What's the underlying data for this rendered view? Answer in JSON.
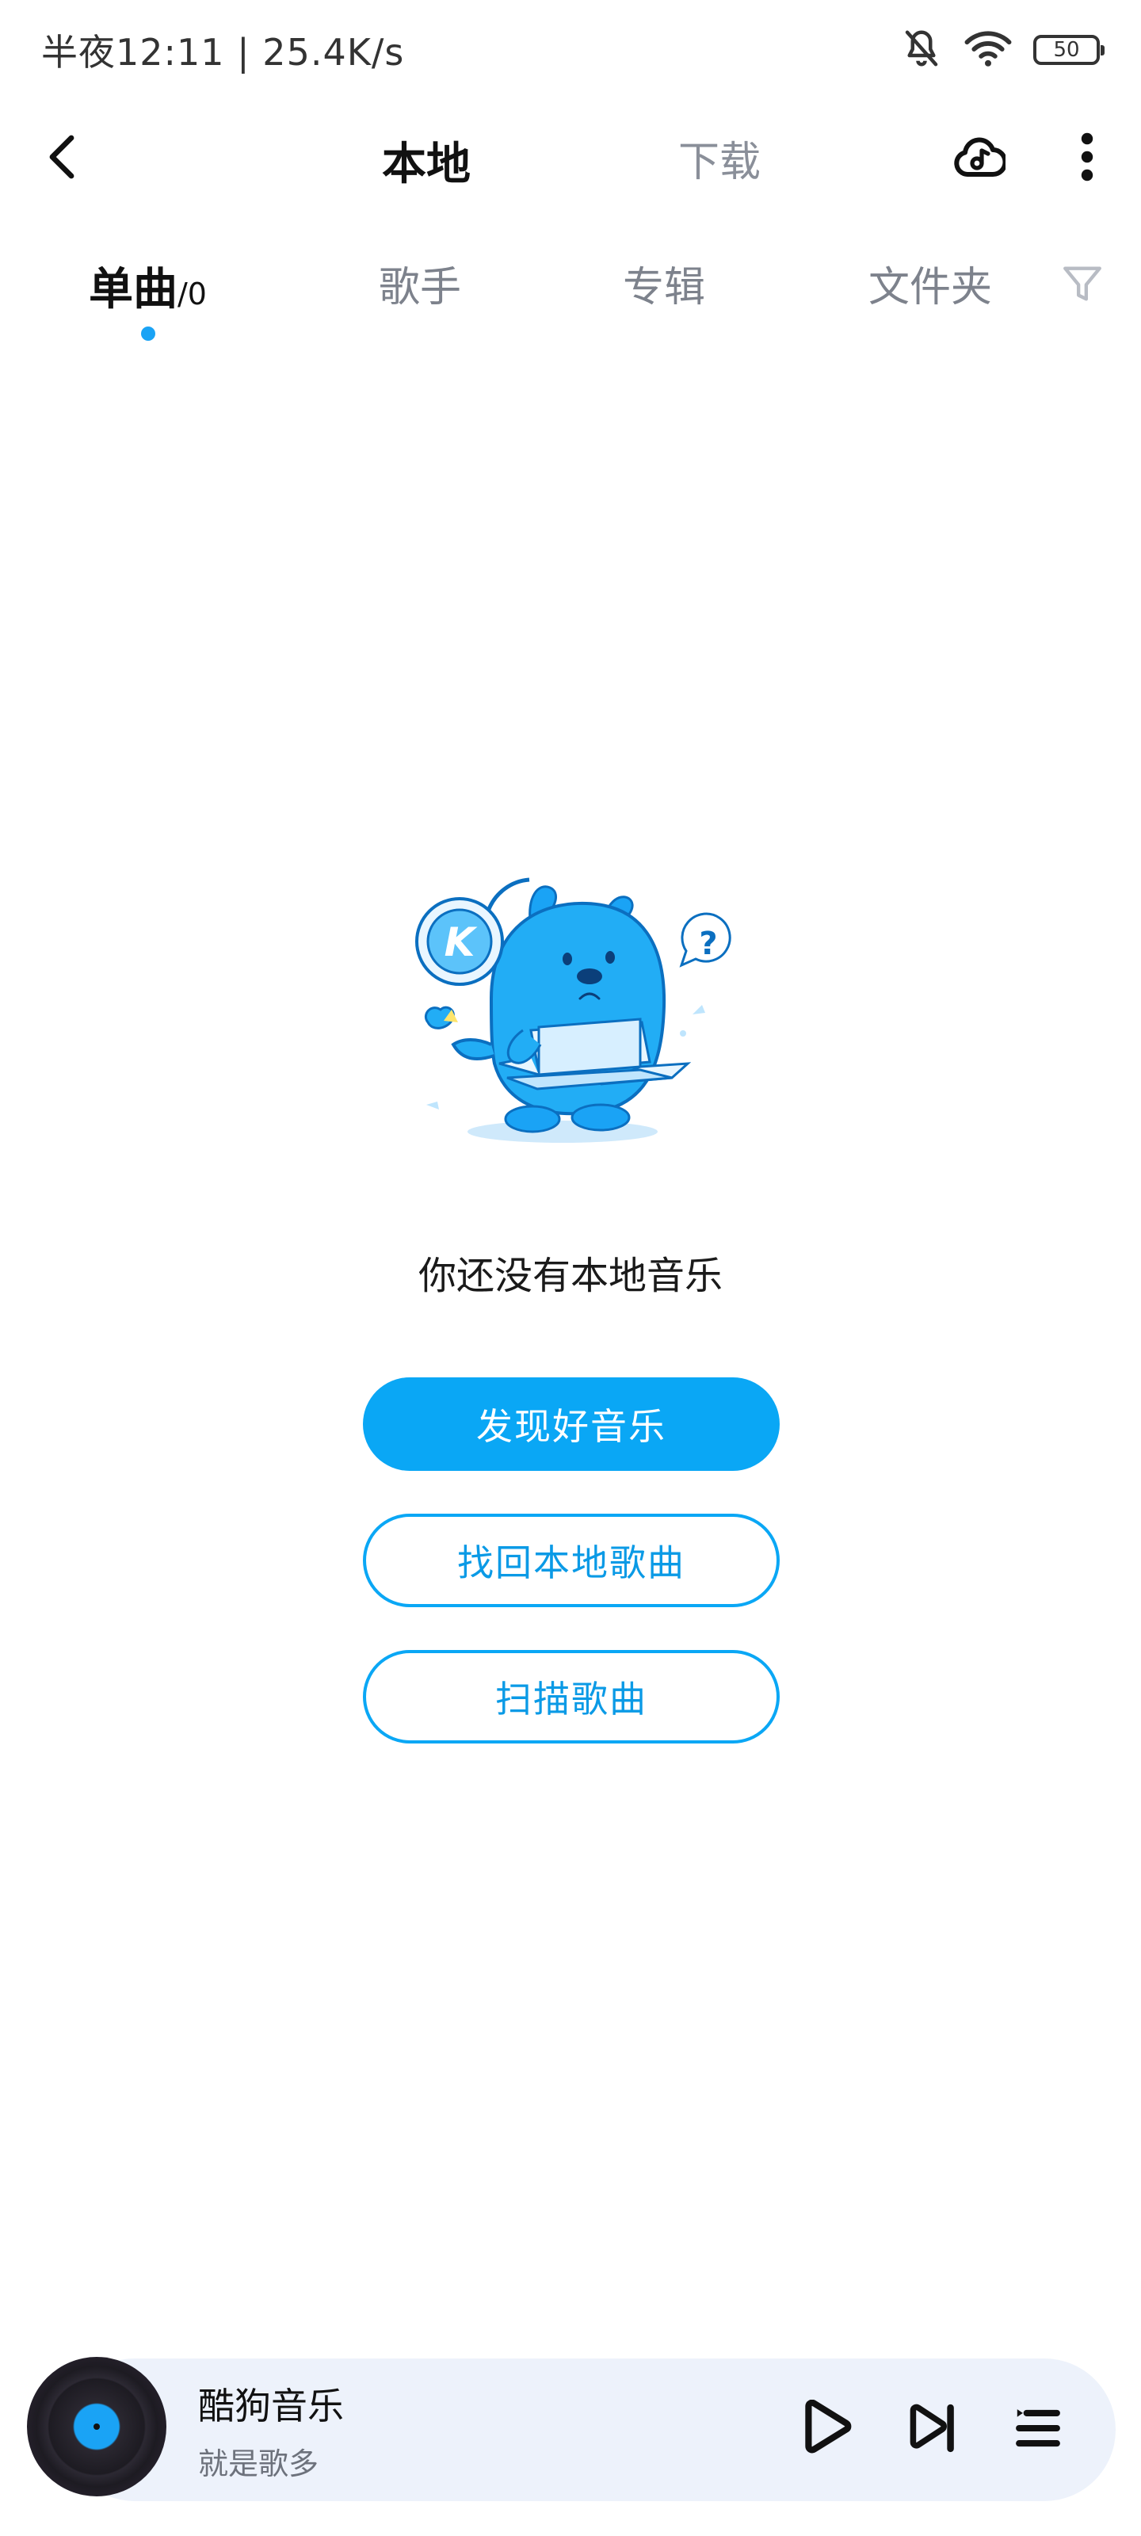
{
  "status_bar": {
    "time_speed": "半夜12:11 | 25.4K/s",
    "battery_level": "50"
  },
  "header": {
    "tabs": [
      {
        "label": "本地"
      },
      {
        "label": "下载"
      }
    ],
    "icons": [
      "back-icon",
      "cloud-music-icon",
      "more-vertical-icon"
    ]
  },
  "sub_tabs": {
    "items": [
      {
        "label": "单曲",
        "count": "/0"
      },
      {
        "label": "歌手"
      },
      {
        "label": "专辑"
      },
      {
        "label": "文件夹"
      }
    ],
    "active_index": 0
  },
  "empty_state": {
    "message": "你还没有本地音乐",
    "mascot_letter": "K",
    "mascot_bubble": "?",
    "buttons": {
      "discover": "发现好音乐",
      "recover": "找回本地歌曲",
      "scan": "扫描歌曲"
    }
  },
  "mini_player": {
    "title": "酷狗音乐",
    "subtitle": "就是歌多",
    "icons": [
      "play-icon",
      "next-track-icon",
      "playlist-icon"
    ]
  },
  "colors": {
    "accent": "#0aa7f5",
    "player_background": "#edf2fb",
    "inactive_text": "#7d828c"
  }
}
